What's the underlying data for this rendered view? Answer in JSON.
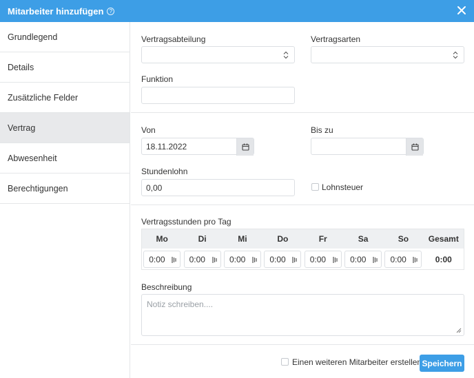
{
  "dialog": {
    "title": "Mitarbeiter hinzufügen",
    "help_symbol": "?",
    "accent_color": "#3d9ee6"
  },
  "sidebar": {
    "items": [
      {
        "label": "Grundlegend",
        "active": false
      },
      {
        "label": "Details",
        "active": false
      },
      {
        "label": "Zusätzliche Felder",
        "active": false
      },
      {
        "label": "Vertrag",
        "active": true
      },
      {
        "label": "Abwesenheit",
        "active": false
      },
      {
        "label": "Berechtigungen",
        "active": false
      }
    ]
  },
  "form": {
    "vertragsabteilung": {
      "label": "Vertragsabteilung",
      "value": ""
    },
    "vertragsarten": {
      "label": "Vertragsarten",
      "value": ""
    },
    "funktion": {
      "label": "Funktion",
      "value": ""
    },
    "von": {
      "label": "Von",
      "value": "18.11.2022"
    },
    "bis_zu": {
      "label": "Bis zu",
      "value": ""
    },
    "stundenlohn": {
      "label": "Stundenlohn",
      "value": "0,00"
    },
    "lohnsteuer": {
      "label": "Lohnsteuer",
      "checked": false
    },
    "hours": {
      "label": "Vertragsstunden pro Tag",
      "days": [
        "Mo",
        "Di",
        "Mi",
        "Do",
        "Fr",
        "Sa",
        "So"
      ],
      "total_label": "Gesamt",
      "values": [
        "0:00",
        "0:00",
        "0:00",
        "0:00",
        "0:00",
        "0:00",
        "0:00"
      ],
      "total": "0:00"
    },
    "beschreibung": {
      "label": "Beschreibung",
      "placeholder": "Notiz schreiben...."
    }
  },
  "footer": {
    "another_label": "Einen weiteren Mitarbeiter erstellen",
    "another_checked": false,
    "save_label": "Speichern"
  }
}
